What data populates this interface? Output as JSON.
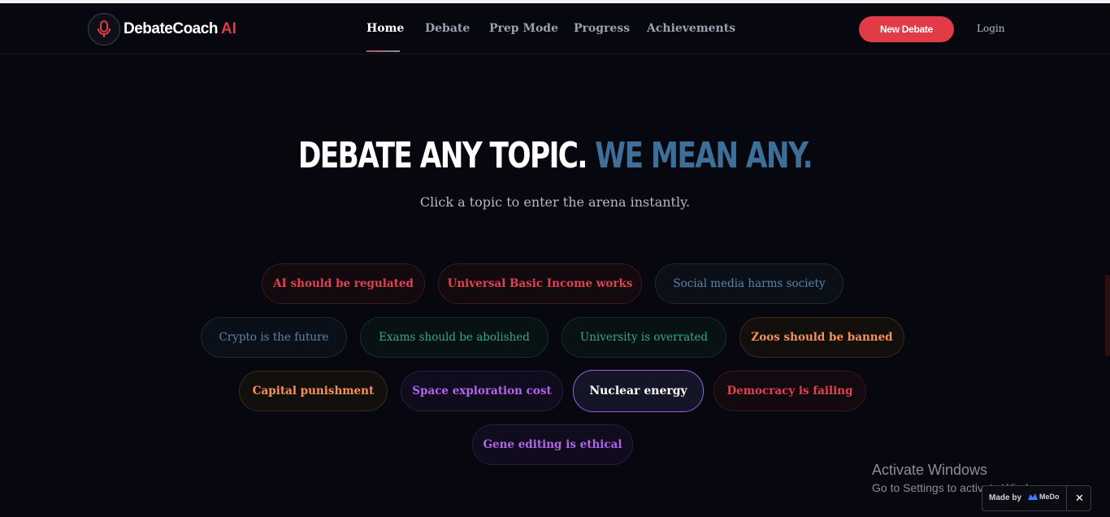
{
  "brand": {
    "name": "DebateCoach",
    "suffix": "AI"
  },
  "nav": {
    "home": "Home",
    "debate": "Debate",
    "prep": "Prep Mode",
    "progress": "Progress",
    "achievements": "Achievements"
  },
  "actions": {
    "new_debate": "New Debate",
    "login": "Login"
  },
  "hero": {
    "title_white": "DEBATE ANY TOPIC.",
    "title_blue": "WE MEAN ANY.",
    "subtitle": "Click a topic to enter the arena instantly."
  },
  "topics": [
    "AI should be regulated",
    "Universal Basic Income works",
    "Social media harms society",
    "Crypto is the future",
    "Exams should be abolished",
    "University is overrated",
    "Zoos should be banned",
    "Capital punishment",
    "Space exploration cost",
    "Nuclear energy",
    "Democracy is failing",
    "Gene editing is ethical"
  ],
  "selected_topic": "Nuclear energy",
  "windows_notice": {
    "line1": "Activate Windows",
    "line2": "Go to Settings to activate Windows."
  },
  "badge": {
    "made_by": "Made by",
    "brand": "MeDo",
    "close": "✕"
  },
  "colors": {
    "accent_red": "#e23b48",
    "accent_blue": "#3e6f99",
    "background": "#07080f"
  }
}
